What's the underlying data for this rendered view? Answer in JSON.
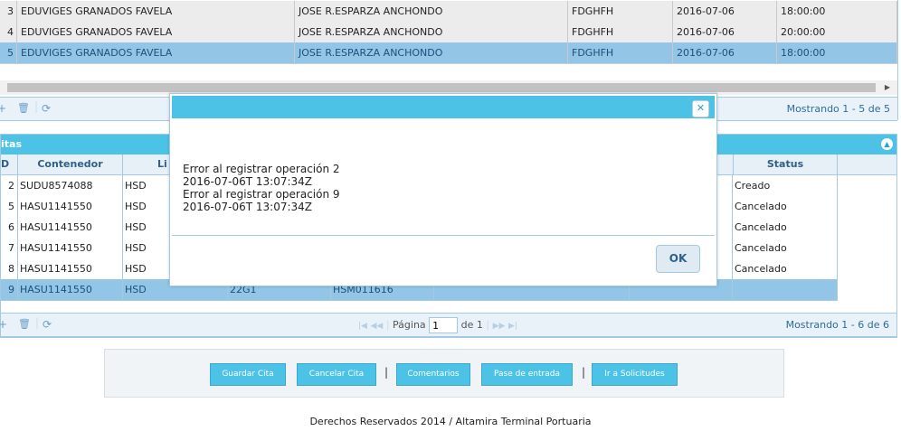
{
  "top_grid": {
    "rows": [
      {
        "id": "3",
        "cliente": "EDUVIGES GRANADOS FAVELA",
        "agente": "JOSE R.ESPARZA ANCHONDO",
        "ref": "FDGHFH",
        "fecha": "2016-07-06",
        "hora": "18:00:00"
      },
      {
        "id": "4",
        "cliente": "EDUVIGES GRANADOS FAVELA",
        "agente": "JOSE R.ESPARZA ANCHONDO",
        "ref": "FDGHFH",
        "fecha": "2016-07-06",
        "hora": "20:00:00"
      },
      {
        "id": "5",
        "cliente": "EDUVIGES GRANADOS FAVELA",
        "agente": "JOSE R.ESPARZA ANCHONDO",
        "ref": "FDGHFH",
        "fecha": "2016-07-06",
        "hora": "18:00:00"
      }
    ],
    "selected_row": 2,
    "pager": {
      "add_icon": "plus-icon",
      "delete_icon": "trash-icon",
      "refresh_icon": "refresh-icon",
      "records": "Mostrando 1 - 5 de 5"
    }
  },
  "bottom_grid": {
    "caption": "itas",
    "columns": [
      "D",
      "Contenedor",
      "Li",
      "Status"
    ],
    "rows": [
      {
        "id": "2",
        "contenedor": "SUDU8574088",
        "linea": "HSD",
        "tipo": "",
        "booking": "",
        "status": "Creado"
      },
      {
        "id": "5",
        "contenedor": "HASU1141550",
        "linea": "HSD",
        "tipo": "",
        "booking": "",
        "status": "Cancelado"
      },
      {
        "id": "6",
        "contenedor": "HASU1141550",
        "linea": "HSD",
        "tipo": "",
        "booking": "",
        "status": "Cancelado"
      },
      {
        "id": "7",
        "contenedor": "HASU1141550",
        "linea": "HSD",
        "tipo": "",
        "booking": "",
        "status": "Cancelado"
      },
      {
        "id": "8",
        "contenedor": "HASU1141550",
        "linea": "HSD",
        "tipo": "",
        "booking": "",
        "status": "Cancelado"
      },
      {
        "id": "9",
        "contenedor": "HASU1141550",
        "linea": "HSD",
        "tipo": "22G1",
        "booking": "HSM011616",
        "status": ""
      }
    ],
    "selected_row": 5,
    "pager": {
      "page_label": "Página",
      "page_value": "1",
      "of_label": "de 1",
      "records": "Mostrando 1 - 6 de 6"
    }
  },
  "actions": {
    "guardar": "Guardar Cita",
    "cancelar": "Cancelar Cita",
    "comentarios": "Comentarios",
    "pase": "Pase de entrada",
    "solicitudes": "Ir a Solicitudes"
  },
  "footer": "Derechos Reservados 2014 / Altamira Terminal Portuaria",
  "modal": {
    "close_label": "✕",
    "message_lines": [
      "Error al registrar operación 2",
      "2016-07-06T 13:07:34Z",
      "Error al registrar operación 9",
      "2016-07-06T 13:07:34Z"
    ],
    "ok_label": "OK"
  },
  "colors": {
    "accent": "#4cc3e6",
    "selected_row": "#92c5e6",
    "grid_border": "#a6c9e2"
  }
}
